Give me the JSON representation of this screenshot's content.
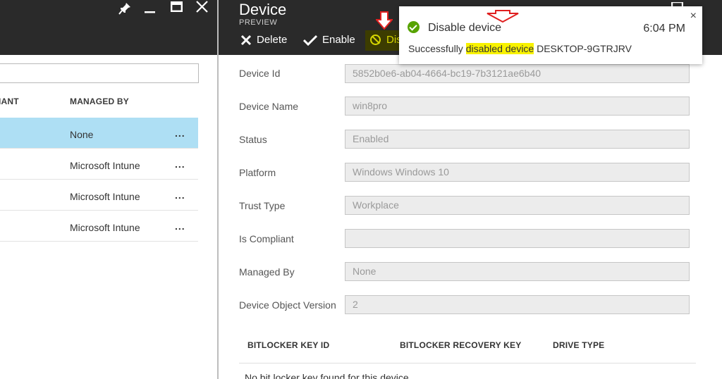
{
  "left_panel": {
    "header_icons": [
      "pin-icon",
      "minimize-icon",
      "maximize-icon",
      "close-icon"
    ],
    "search": {
      "value": "",
      "placeholder": ""
    },
    "columns": [
      "IANT",
      "MANAGED BY"
    ],
    "rows": [
      {
        "managed_by": "None",
        "more": "...",
        "selected": true
      },
      {
        "managed_by": "Microsoft Intune",
        "more": "..."
      },
      {
        "managed_by": "Microsoft Intune",
        "more": "..."
      },
      {
        "managed_by": "Microsoft Intune",
        "more": "..."
      }
    ]
  },
  "blade": {
    "title": "Device",
    "subtitle": "PREVIEW",
    "commands": {
      "delete": "Delete",
      "enable": "Enable",
      "disable": "Dis"
    },
    "fields": [
      {
        "label": "Device Id",
        "value": "5852b0e6-ab04-4664-bc19-7b3121ae6b40"
      },
      {
        "label": "Device Name",
        "value": "win8pro"
      },
      {
        "label": "Status",
        "value": "Enabled"
      },
      {
        "label": "Platform",
        "value": "Windows Windows 10"
      },
      {
        "label": "Trust Type",
        "value": "Workplace"
      },
      {
        "label": "Is Compliant",
        "value": ""
      },
      {
        "label": "Managed By",
        "value": "None"
      },
      {
        "label": "Device Object Version",
        "value": "2"
      }
    ],
    "bitlocker": {
      "headers": [
        "BITLOCKER KEY ID",
        "BITLOCKER RECOVERY KEY",
        "DRIVE TYPE"
      ],
      "empty_message": "No bit locker key found for this device"
    }
  },
  "toast": {
    "title": "Disable device",
    "time": "6:04 PM",
    "close": "×",
    "message_prefix": "Successfully ",
    "message_highlight": "disabled device",
    "message_suffix": " DESKTOP-9GTRJRV"
  },
  "colors": {
    "header_bg": "#2a2a2a",
    "selected_row": "#aedff4",
    "success_green": "#57a300",
    "disable_yellow": "#d8d800",
    "highlight_yellow": "#f8f200",
    "annotation_red": "#e02020"
  }
}
